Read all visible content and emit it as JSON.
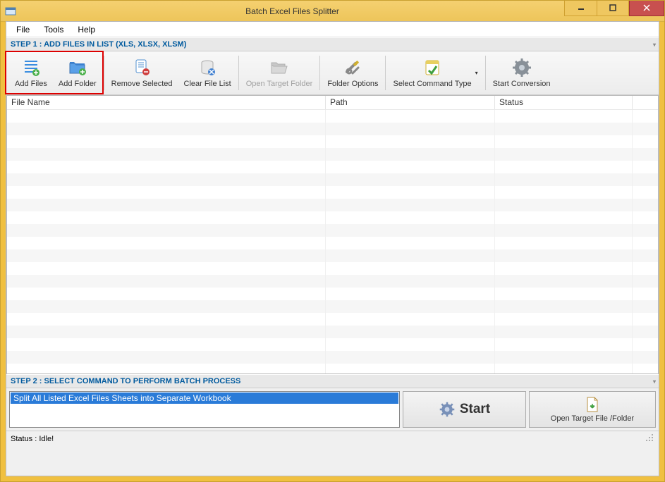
{
  "window": {
    "title": "Batch Excel Files Splitter"
  },
  "menu": {
    "file": "File",
    "tools": "Tools",
    "help": "Help"
  },
  "step1_label": "STEP 1 : ADD FILES IN LIST (XLS, XLSX, XLSM)",
  "toolbar": {
    "add_files": "Add Files",
    "add_folder": "Add Folder",
    "remove_selected": "Remove Selected",
    "clear_list": "Clear File List",
    "open_target": "Open Target Folder",
    "folder_options": "Folder Options",
    "select_command": "Select Command Type",
    "start_conversion": "Start Conversion"
  },
  "columns": {
    "file_name": "File Name",
    "path": "Path",
    "status": "Status"
  },
  "step2_label": "STEP 2 : SELECT COMMAND TO PERFORM BATCH PROCESS",
  "command_selected": "Split All Listed Excel Files Sheets into Separate Workbook",
  "buttons": {
    "start": "Start",
    "open_folder": "Open Target File /Folder"
  },
  "status_text": "Status  :  Idle!"
}
